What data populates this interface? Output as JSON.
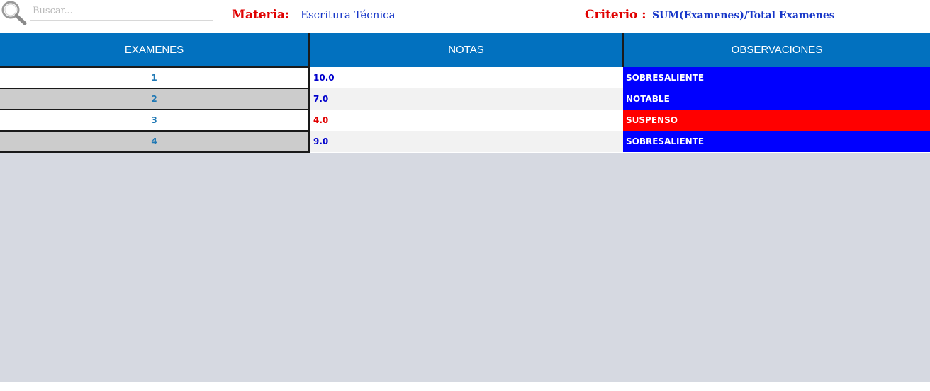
{
  "search": {
    "placeholder": "Buscar..."
  },
  "header": {
    "materia_label": "Materia:",
    "materia_value": "Escritura Técnica",
    "criterio_label": "Criterio :",
    "criterio_value": "SUM(Examenes)/Total Examenes"
  },
  "table": {
    "columns": [
      "EXAMENES",
      "NOTAS",
      "OBSERVACIONES"
    ],
    "rows": [
      {
        "examen": "1",
        "nota": "10.0",
        "nota_color": "#0000cc",
        "observacion": "SOBRESALIENTE",
        "obs_color": "#0000ff"
      },
      {
        "examen": "2",
        "nota": "7.0",
        "nota_color": "#0000cc",
        "observacion": "NOTABLE",
        "obs_color": "#0000ff"
      },
      {
        "examen": "3",
        "nota": "4.0",
        "nota_color": "#e00000",
        "observacion": "SUSPENSO",
        "obs_color": "#ff0000"
      },
      {
        "examen": "4",
        "nota": "9.0",
        "nota_color": "#0000cc",
        "observacion": "SOBRESALIENTE",
        "obs_color": "#0000ff"
      }
    ]
  },
  "colors": {
    "header_bg": "#0271bf",
    "label_red": "#e00000",
    "value_blue": "#1636c8",
    "empty_area_bg": "#d6d9e1"
  },
  "icons": {
    "search": "search-icon"
  }
}
